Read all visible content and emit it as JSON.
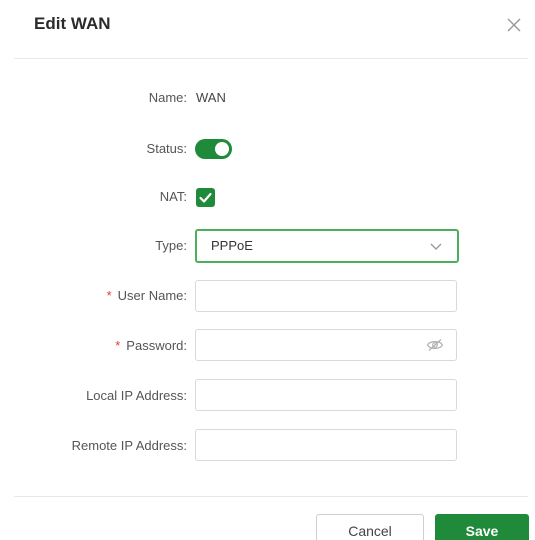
{
  "dialog": {
    "title": "Edit WAN"
  },
  "form": {
    "name": {
      "label": "Name:",
      "value": "WAN"
    },
    "status": {
      "label": "Status:",
      "enabled": true
    },
    "nat": {
      "label": "NAT:",
      "checked": true
    },
    "type": {
      "label": "Type:",
      "selected": "PPPoE"
    },
    "username": {
      "required_mark": "*",
      "label": "User Name:",
      "value": ""
    },
    "password": {
      "required_mark": "*",
      "label": "Password:",
      "value": ""
    },
    "local_ip": {
      "label": "Local IP Address:",
      "value": ""
    },
    "remote_ip": {
      "label": "Remote IP Address:",
      "value": ""
    }
  },
  "footer": {
    "cancel_label": "Cancel",
    "save_label": "Save"
  },
  "colors": {
    "accent": "#1e8a3a",
    "select_border": "#4caf5a",
    "required": "#e53935"
  },
  "icons": {
    "close": "close-icon",
    "chevron": "chevron-down-icon",
    "eye": "eye-off-icon",
    "check": "check-icon"
  }
}
